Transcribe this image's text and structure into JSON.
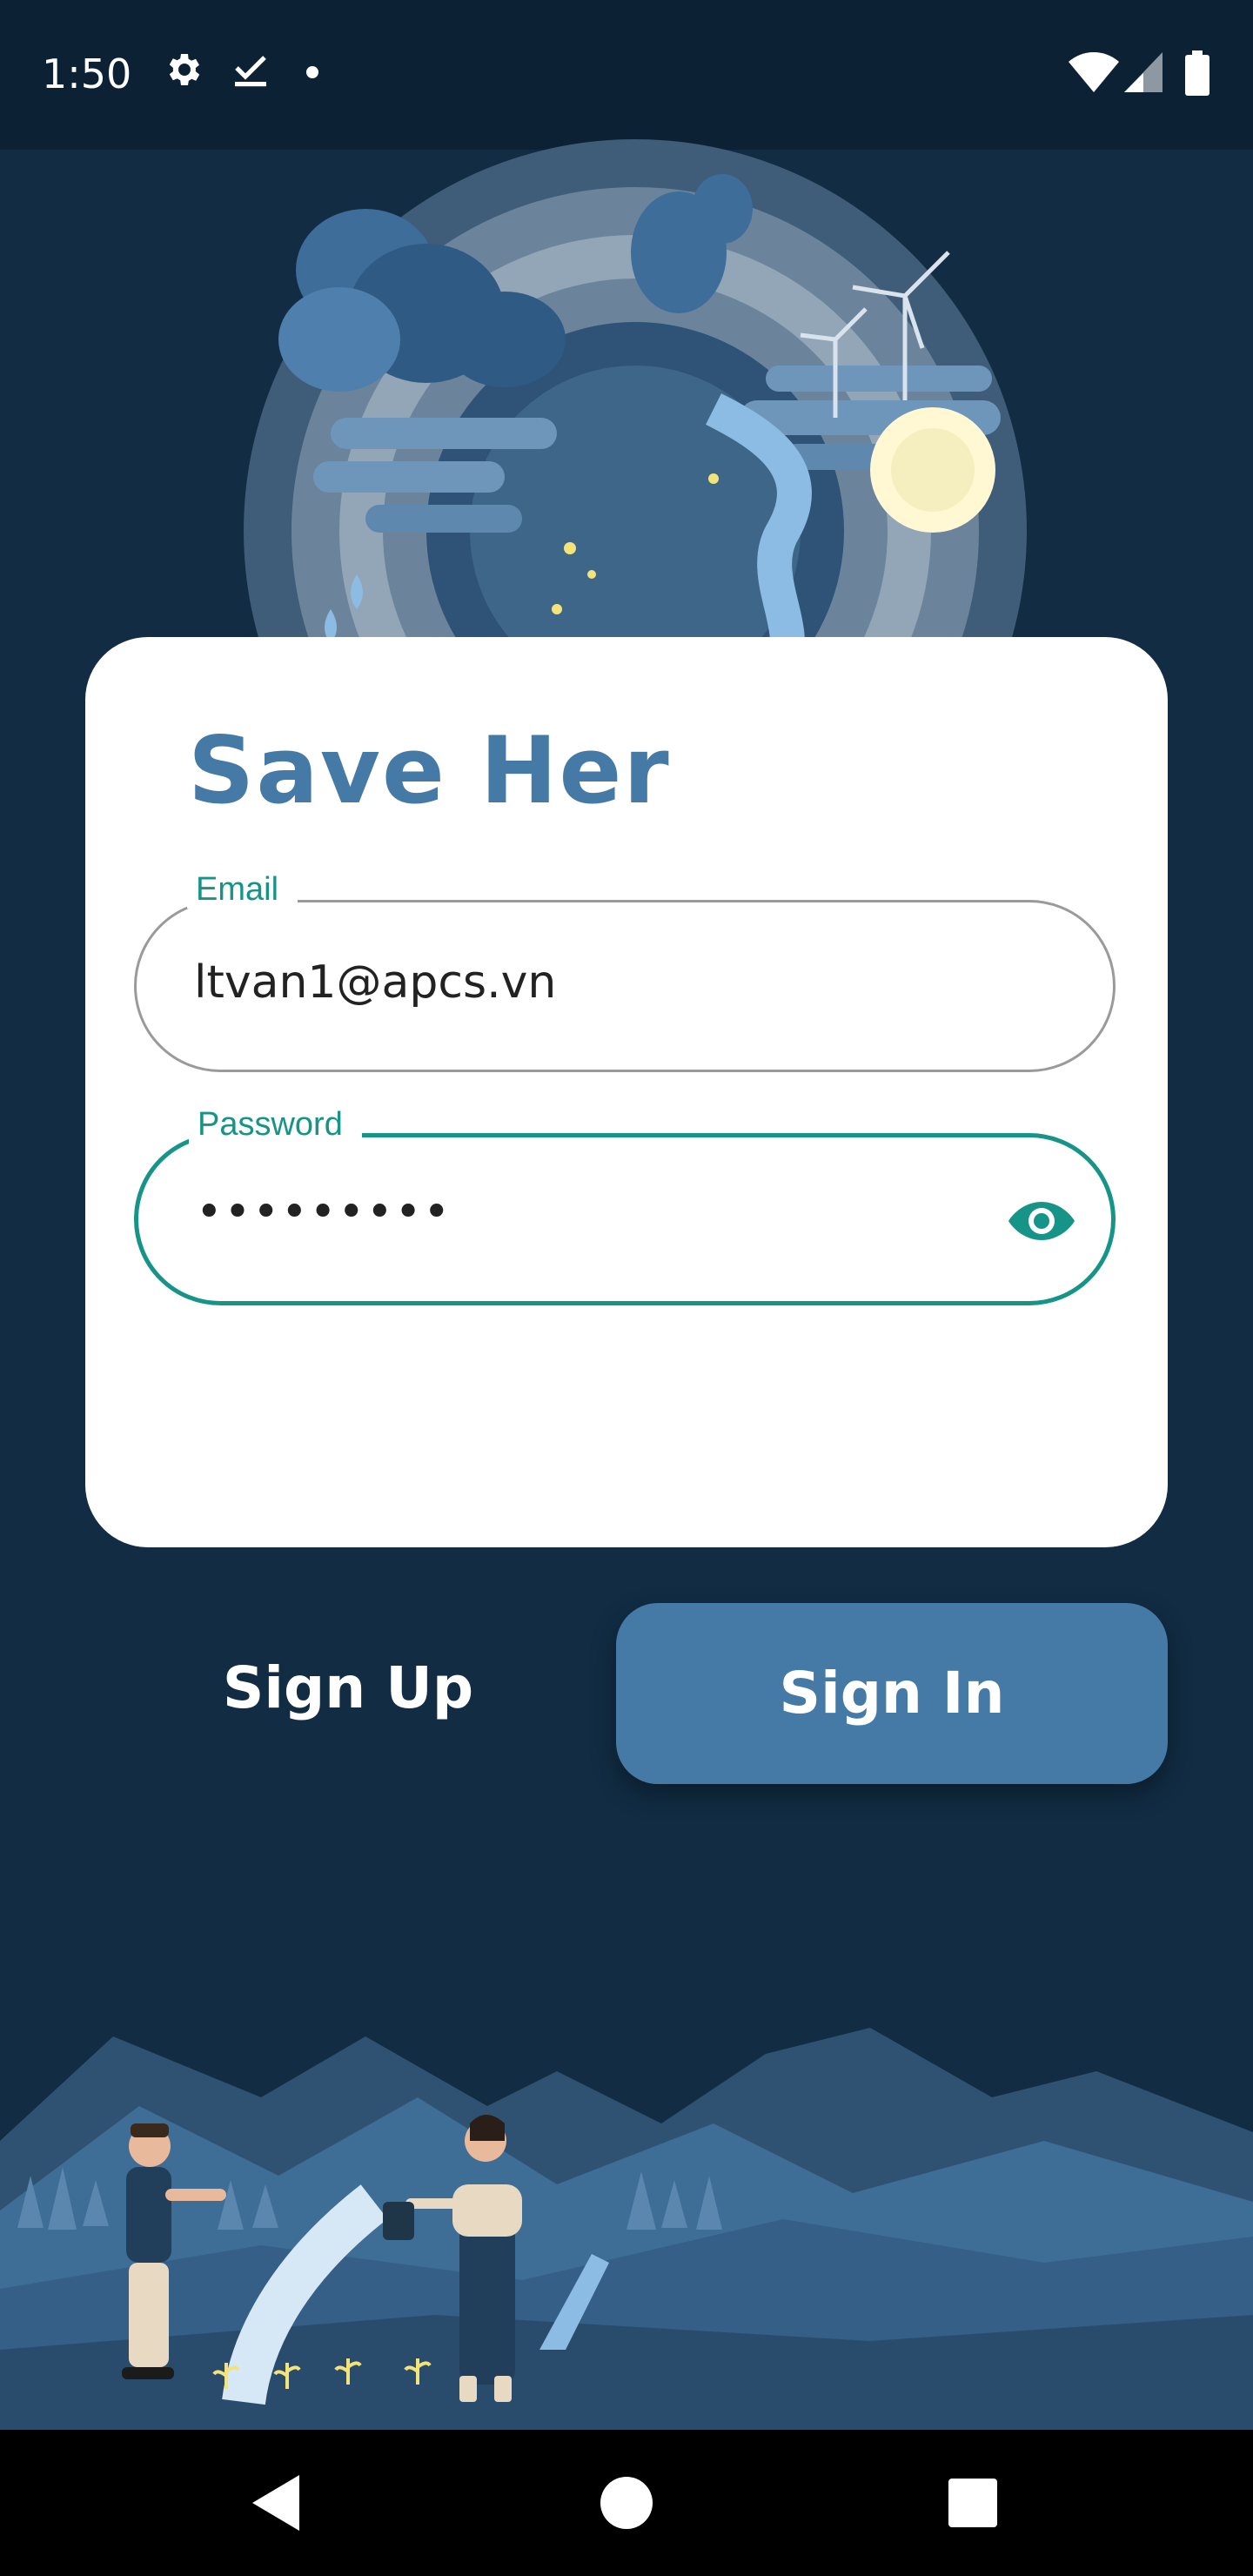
{
  "status_bar": {
    "time": "1:50",
    "left_icons": [
      "gear-icon",
      "checkmark-download-icon",
      "dot-icon"
    ],
    "right_icons": [
      "wifi-icon",
      "cell-signal-icon",
      "battery-icon"
    ]
  },
  "app": {
    "title": "Save Her"
  },
  "form": {
    "email": {
      "label": "Email",
      "value": "ltvan1@apcs.vn"
    },
    "password": {
      "label": "Password",
      "value": "•••••••••",
      "toggle_icon": "eye-icon"
    }
  },
  "actions": {
    "signup_label": "Sign Up",
    "signin_label": "Sign In"
  },
  "colors": {
    "background": "#112c43",
    "accent": "#457aa7",
    "teal": "#169487",
    "card": "#ffffff"
  },
  "navigation": {
    "icons": [
      "back-triangle-icon",
      "home-circle-icon",
      "recents-square-icon"
    ]
  }
}
